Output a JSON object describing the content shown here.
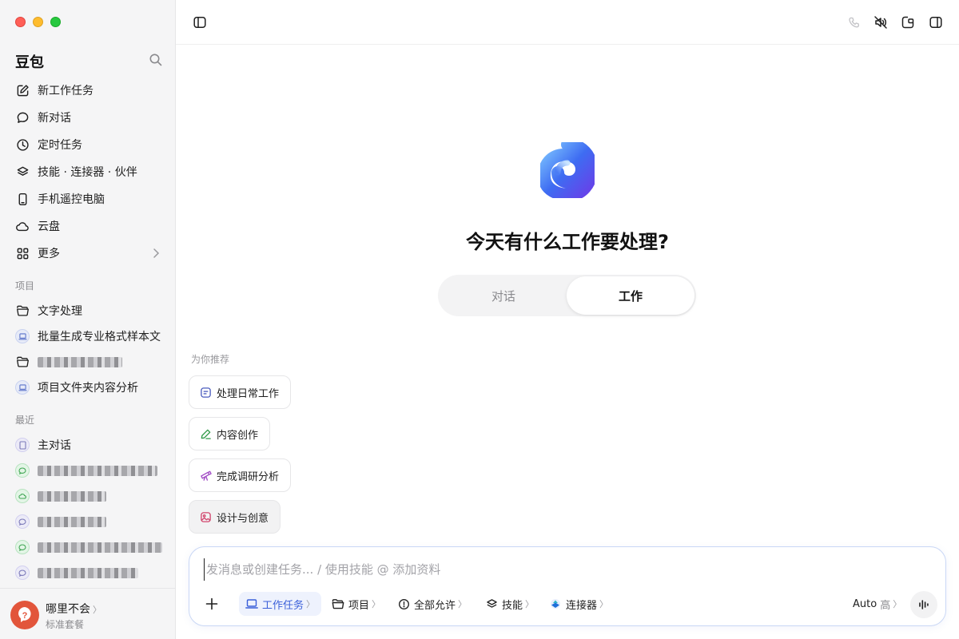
{
  "sidebar": {
    "brand": "豆包",
    "nav": [
      {
        "label": "新工作任务"
      },
      {
        "label": "新对话"
      },
      {
        "label": "定时任务"
      },
      {
        "label": "技能 · 连接器 · 伙伴"
      },
      {
        "label": "手机遥控电脑"
      },
      {
        "label": "云盘"
      },
      {
        "label": "更多"
      }
    ],
    "projects_heading": "项目",
    "projects": [
      {
        "label": "文字处理"
      },
      {
        "label": "批量生成专业格式样本文"
      },
      {
        "label": ""
      },
      {
        "label": "项目文件夹内容分析"
      }
    ],
    "recent_heading": "最近",
    "recent": [
      {
        "label": "主对话"
      },
      {
        "label": ""
      },
      {
        "label": ""
      },
      {
        "label": ""
      },
      {
        "label": ""
      },
      {
        "label": ""
      }
    ],
    "user": {
      "name": "哪里不会",
      "plan": "标准套餐"
    }
  },
  "main": {
    "headline": "今天有什么工作要处理?",
    "segments": {
      "left": "对话",
      "right": "工作",
      "selected": "工作"
    },
    "recommend_heading": "为你推荐",
    "chips": [
      {
        "label": "处理日常工作",
        "icon": "document-icon"
      },
      {
        "label": "内容创作",
        "icon": "pen-icon"
      },
      {
        "label": "完成调研分析",
        "icon": "telescope-icon"
      },
      {
        "label": "设计与创意",
        "icon": "image-icon"
      }
    ],
    "composer": {
      "placeholder": "发消息或创建任务... / 使用技能 @ 添加资料",
      "tools": {
        "work_task": "工作任务",
        "project": "项目",
        "permission": "全部允许",
        "skill": "技能",
        "connector": "连接器"
      },
      "model": "Auto",
      "model_level": "高"
    }
  },
  "colors": {
    "accent": "#3a5fd9",
    "sidebar_bg": "#f5f5f6"
  }
}
